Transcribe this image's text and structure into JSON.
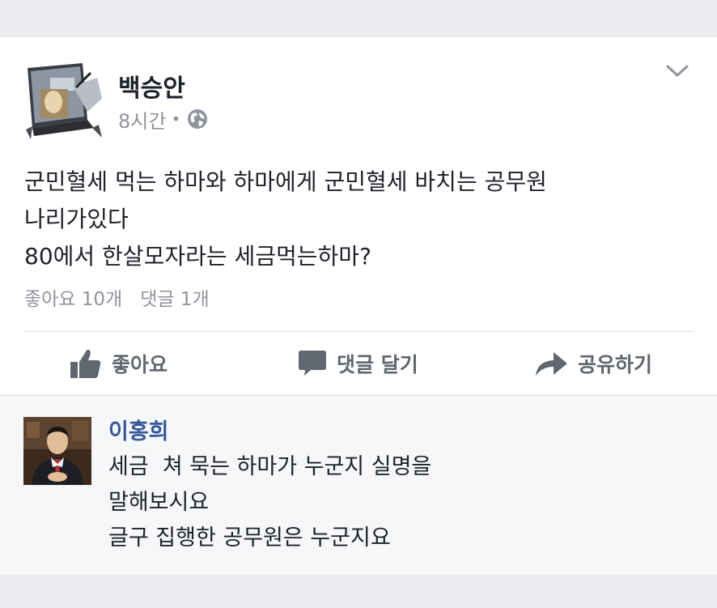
{
  "post": {
    "author": "백승안",
    "time": "8시간",
    "separator": "•",
    "privacy_icon": "globe-icon",
    "menu_icon": "chevron-down-icon",
    "text_lines": [
      "군민혈세 먹는 하마와 하마에게 군민혈세 바치는 공무원",
      "나리가있다",
      "80에서 한살모자라는 세금먹는하마?"
    ],
    "likes": "좋아요 10개",
    "comments_count": "댓글 1개"
  },
  "actions": {
    "like": {
      "label": "좋아요",
      "icon": "thumbs-up-icon"
    },
    "comment": {
      "label": "댓글 달기",
      "icon": "speech-bubble-icon"
    },
    "share": {
      "label": "공유하기",
      "icon": "share-arrow-icon"
    }
  },
  "comment": {
    "author": "이홍희",
    "text_lines": [
      "세금  쳐 묵는 하마가 누군지 실명을",
      "말해보시요",
      "글구 집행한 공무원은 누군지요"
    ]
  },
  "colors": {
    "background": "#e9ebee",
    "card": "#ffffff",
    "meta_text": "#90949c",
    "action_text": "#606770",
    "comment_bg": "#f6f7f9",
    "link_name": "#365899"
  }
}
